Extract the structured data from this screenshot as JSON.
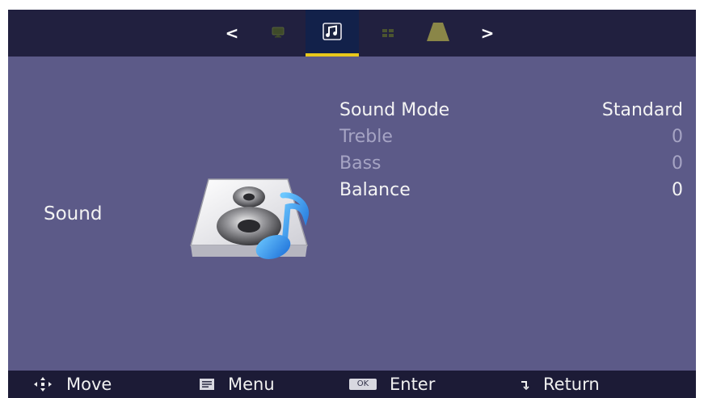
{
  "tabs": {
    "prev_arrow": "<",
    "next_arrow": ">",
    "items": [
      {
        "icon": "picture-icon",
        "active": false
      },
      {
        "icon": "sound-icon",
        "active": true
      },
      {
        "icon": "channel-icon",
        "active": false
      },
      {
        "icon": "lock-icon",
        "active": false
      }
    ]
  },
  "category": {
    "label": "Sound",
    "icon": "speaker-music-icon"
  },
  "settings": [
    {
      "label": "Sound Mode",
      "value": "Standard",
      "enabled": true
    },
    {
      "label": "Treble",
      "value": "0",
      "enabled": false
    },
    {
      "label": "Bass",
      "value": "0",
      "enabled": false
    },
    {
      "label": "Balance",
      "value": "0",
      "enabled": true
    }
  ],
  "hints": {
    "move": {
      "icon": "dpad-icon",
      "label": "Move"
    },
    "menu": {
      "icon": "menu-icon",
      "label": "Menu"
    },
    "enter": {
      "icon": "ok-icon",
      "icon_text": "OK",
      "label": "Enter"
    },
    "return": {
      "icon": "return-icon",
      "label": "Return"
    }
  },
  "colors": {
    "background": "#5c5a88",
    "tab_bar": "#21203f",
    "active_underline": "#e8c81a",
    "hint_bar": "#1c1b36"
  }
}
